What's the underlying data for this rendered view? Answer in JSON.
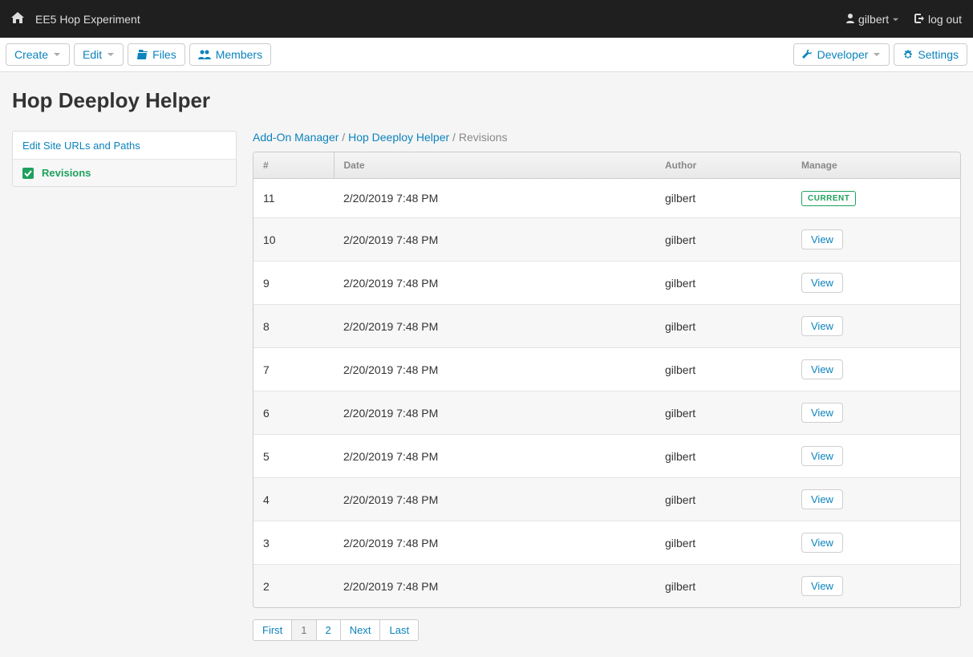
{
  "topbar": {
    "site_name": "EE5 Hop Experiment",
    "user": "gilbert",
    "logout": "log out"
  },
  "toolbar": {
    "create": "Create",
    "edit": "Edit",
    "files": "Files",
    "members": "Members",
    "developer": "Developer",
    "settings": "Settings"
  },
  "page_title": "Hop Deeploy Helper",
  "sidebar": {
    "edit_urls": "Edit Site URLs and Paths",
    "revisions": "Revisions"
  },
  "breadcrumb": {
    "a": "Add-On Manager",
    "b": "Hop Deeploy Helper",
    "c": "Revisions",
    "sep": " / "
  },
  "table": {
    "cols": [
      "#",
      "Date",
      "Author",
      "Manage"
    ],
    "current_label": "CURRENT",
    "view_label": "View",
    "rows": [
      {
        "n": "11",
        "date": "2/20/2019 7:48 PM",
        "author": "gilbert",
        "current": true
      },
      {
        "n": "10",
        "date": "2/20/2019 7:48 PM",
        "author": "gilbert",
        "current": false
      },
      {
        "n": "9",
        "date": "2/20/2019 7:48 PM",
        "author": "gilbert",
        "current": false
      },
      {
        "n": "8",
        "date": "2/20/2019 7:48 PM",
        "author": "gilbert",
        "current": false
      },
      {
        "n": "7",
        "date": "2/20/2019 7:48 PM",
        "author": "gilbert",
        "current": false
      },
      {
        "n": "6",
        "date": "2/20/2019 7:48 PM",
        "author": "gilbert",
        "current": false
      },
      {
        "n": "5",
        "date": "2/20/2019 7:48 PM",
        "author": "gilbert",
        "current": false
      },
      {
        "n": "4",
        "date": "2/20/2019 7:48 PM",
        "author": "gilbert",
        "current": false
      },
      {
        "n": "3",
        "date": "2/20/2019 7:48 PM",
        "author": "gilbert",
        "current": false
      },
      {
        "n": "2",
        "date": "2/20/2019 7:48 PM",
        "author": "gilbert",
        "current": false
      }
    ]
  },
  "pagination": {
    "first": "First",
    "p1": "1",
    "p2": "2",
    "next": "Next",
    "last": "Last"
  }
}
